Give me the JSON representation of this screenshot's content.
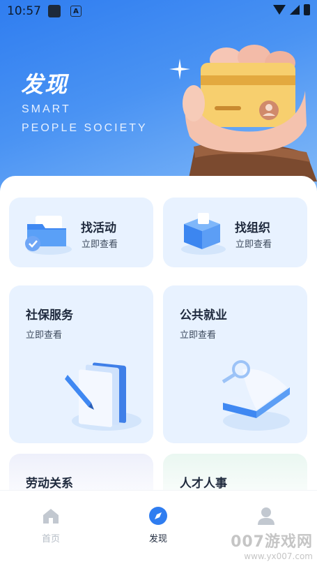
{
  "status_bar": {
    "time": "10:57",
    "app_badge": "A"
  },
  "hero": {
    "title": "发现",
    "subtitle_line1": "SMART",
    "subtitle_line2": "PEOPLE SOCIETY"
  },
  "cards": [
    {
      "title": "找活动",
      "subtitle": "立即查看"
    },
    {
      "title": "找组织",
      "subtitle": "立即查看"
    },
    {
      "title": "社保服务",
      "subtitle": "立即查看"
    },
    {
      "title": "公共就业",
      "subtitle": "立即查看"
    },
    {
      "title": "劳动关系"
    },
    {
      "title": "人才人事"
    }
  ],
  "bottom_nav": {
    "items": [
      {
        "label": "首页",
        "icon": "home-icon",
        "active": false
      },
      {
        "label": "发现",
        "icon": "compass-icon",
        "active": true
      },
      {
        "label": "",
        "icon": "user-icon",
        "active": false
      }
    ]
  },
  "watermark": {
    "logo": "007游戏网",
    "url": "www.yx007.com"
  },
  "colors": {
    "primary": "#2f7df0",
    "card_bg": "#e8f2ff",
    "text": "#1f2a3d",
    "nav_inactive": "#b5bcc6"
  }
}
